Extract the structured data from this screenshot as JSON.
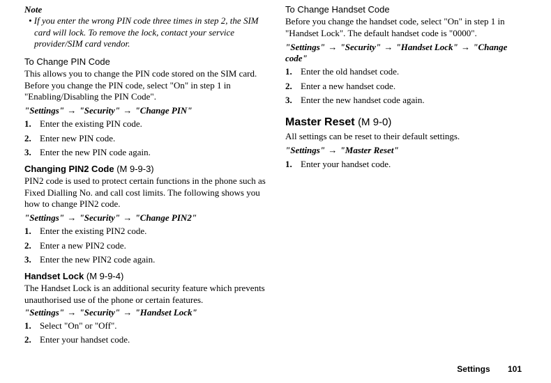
{
  "note": {
    "heading": "Note",
    "body": "• If you enter the wrong PIN code three times in step 2, the SIM card will lock. To remove the lock, contact your service provider/SIM card vendor."
  },
  "changePin": {
    "heading": "To Change PIN Code",
    "body": "This allows you to change the PIN code stored on the SIM card. Before you change the PIN code, select \"On\" in step 1 in \"Enabling/Disabling the PIN Code\".",
    "path": [
      "\"Settings\"",
      "\"Security\"",
      "\"Change PIN\""
    ],
    "steps": [
      "Enter the existing PIN code.",
      "Enter new PIN code.",
      "Enter the new PIN code again."
    ]
  },
  "changePin2": {
    "heading": "Changing PIN2 Code",
    "mcode": "(M 9-9-3)",
    "body": "PIN2 code is used to protect certain functions in the phone such as Fixed Dialling No. and call cost limits. The following shows you how to change PIN2 code.",
    "path": [
      "\"Settings\"",
      "\"Security\"",
      "\"Change PIN2\""
    ],
    "steps": [
      "Enter the existing PIN2 code.",
      "Enter a new PIN2 code.",
      "Enter the new PIN2 code again."
    ]
  },
  "handsetLock": {
    "heading": "Handset Lock",
    "mcode": "(M 9-9-4)",
    "body": "The Handset Lock is an additional security feature which prevents unauthorised use of the phone or certain features.",
    "path": [
      "\"Settings\"",
      "\"Security\"",
      "\"Handset Lock\""
    ],
    "steps": [
      "Select \"On\" or \"Off\".",
      "Enter your handset code."
    ]
  },
  "changeHandset": {
    "heading": "To Change Handset Code",
    "body": "Before you change the handset code, select \"On\" in step 1 in \"Handset Lock\". The default handset code is \"0000\".",
    "path": [
      "\"Settings\"",
      "\"Security\"",
      "\"Handset Lock\"",
      "\"Change code\""
    ],
    "steps": [
      "Enter the old handset code.",
      "Enter a new handset code.",
      "Enter the new handset code again."
    ]
  },
  "masterReset": {
    "heading": "Master Reset",
    "mcode": "(M 9-0)",
    "body": "All settings can be reset to their default settings.",
    "path": [
      "\"Settings\"",
      "\"Master Reset\""
    ],
    "steps": [
      "Enter your handset code."
    ]
  },
  "footer": {
    "section": "Settings",
    "page": "101"
  },
  "arrow": "→"
}
